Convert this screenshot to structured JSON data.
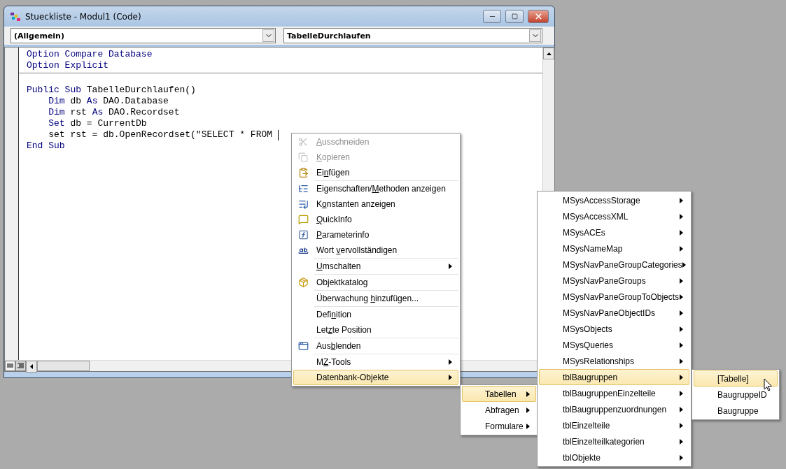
{
  "window": {
    "title": "Stueckliste - Modul1 (Code)"
  },
  "object_combo": {
    "value": "(Allgemein)"
  },
  "procedure_combo": {
    "value": "TabelleDurchlaufen"
  },
  "code": {
    "sections": [
      {
        "lines": [
          {
            "tokens": [
              {
                "kind": "keyword",
                "text": "Option Compare Database"
              }
            ]
          },
          {
            "tokens": [
              {
                "kind": "keyword",
                "text": "Option Explicit"
              }
            ]
          }
        ]
      },
      {
        "lines": [
          {
            "tokens": [
              {
                "kind": "keyword",
                "text": "Public Sub"
              },
              {
                "kind": "plain",
                "text": " TabelleDurchlaufen()"
              }
            ]
          },
          {
            "tokens": [
              {
                "kind": "keyword",
                "text": "    Dim"
              },
              {
                "kind": "plain",
                "text": " db "
              },
              {
                "kind": "keyword",
                "text": "As"
              },
              {
                "kind": "plain",
                "text": " DAO.Database"
              }
            ]
          },
          {
            "tokens": [
              {
                "kind": "keyword",
                "text": "    Dim"
              },
              {
                "kind": "plain",
                "text": " rst "
              },
              {
                "kind": "keyword",
                "text": "As"
              },
              {
                "kind": "plain",
                "text": " DAO.Recordset"
              }
            ]
          },
          {
            "tokens": [
              {
                "kind": "keyword",
                "text": "    Set"
              },
              {
                "kind": "plain",
                "text": " db = CurrentDb"
              }
            ]
          },
          {
            "tokens": [
              {
                "kind": "plain",
                "text": "    set rst = db.OpenRecordset(\"SELECT * FROM "
              }
            ],
            "cursor": true
          },
          {
            "tokens": [
              {
                "kind": "keyword",
                "text": "End Sub"
              }
            ]
          }
        ]
      }
    ]
  },
  "context_menu": {
    "groups": [
      {
        "items": [
          {
            "label": {
              "key": "A",
              "post": "usschneiden"
            },
            "disabled": true,
            "submenu": false,
            "selected": false
          },
          {
            "label": {
              "key": "K",
              "post": "opieren"
            },
            "disabled": true,
            "submenu": false,
            "selected": false
          },
          {
            "label": {
              "pre": "Ei",
              "key": "n",
              "post": "fügen"
            },
            "disabled": false,
            "submenu": false,
            "selected": false
          }
        ]
      },
      {
        "items": [
          {
            "label": {
              "pre": "Eigenschaften/",
              "key": "M",
              "post": "ethoden anzeigen"
            },
            "disabled": false,
            "submenu": false,
            "selected": false
          },
          {
            "label": {
              "pre": "K",
              "key": "o",
              "post": "nstanten anzeigen"
            },
            "disabled": false,
            "submenu": false,
            "selected": false
          },
          {
            "label": {
              "key": "Q",
              "post": "uickInfo"
            },
            "disabled": false,
            "submenu": false,
            "selected": false
          },
          {
            "label": {
              "key": "P",
              "post": "arameterinfo"
            },
            "disabled": false,
            "submenu": false,
            "selected": false
          },
          {
            "label": {
              "pre": "Wort ",
              "key": "v",
              "post": "ervollständigen"
            },
            "disabled": false,
            "submenu": false,
            "selected": false
          }
        ]
      },
      {
        "items": [
          {
            "label": {
              "key": "U",
              "post": "mschalten"
            },
            "disabled": false,
            "submenu": true,
            "selected": false
          }
        ]
      },
      {
        "items": [
          {
            "label": {
              "pre": "Ob",
              "key": "j",
              "post": "ektkatalog"
            },
            "disabled": false,
            "submenu": false,
            "selected": false
          }
        ]
      },
      {
        "items": [
          {
            "label": {
              "pre": "Überwachung ",
              "key": "h",
              "post": "inzufügen..."
            },
            "disabled": false,
            "submenu": false,
            "selected": false
          }
        ]
      },
      {
        "items": [
          {
            "label": {
              "pre": "Defi",
              "key": "n",
              "post": "ition"
            },
            "disabled": false,
            "submenu": false,
            "selected": false
          },
          {
            "label": {
              "pre": "Let",
              "key": "z",
              "post": "te Position"
            },
            "disabled": false,
            "submenu": false,
            "selected": false
          }
        ]
      },
      {
        "items": [
          {
            "label": {
              "pre": "Aus",
              "key": "b",
              "post": "lenden"
            },
            "disabled": false,
            "submenu": false,
            "selected": false
          }
        ]
      },
      {
        "items": [
          {
            "label": {
              "pre": "M",
              "key": "Z",
              "post": "-Tools"
            },
            "disabled": false,
            "submenu": true,
            "selected": false
          },
          {
            "label": {
              "pre": "Datenbank-Objekte"
            },
            "disabled": false,
            "submenu": true,
            "selected": true
          }
        ]
      }
    ]
  },
  "submenus": [
    {
      "items": [
        {
          "label": "Tabellen",
          "submenu": true,
          "selected": true
        },
        {
          "label": "Abfragen",
          "submenu": true,
          "selected": false
        },
        {
          "label": "Formulare",
          "submenu": true,
          "selected": false
        }
      ]
    },
    {
      "items": [
        {
          "label": "MSysAccessStorage",
          "submenu": true,
          "selected": false
        },
        {
          "label": "MSysAccessXML",
          "submenu": true,
          "selected": false
        },
        {
          "label": "MSysACEs",
          "submenu": true,
          "selected": false
        },
        {
          "label": "MSysNameMap",
          "submenu": true,
          "selected": false
        },
        {
          "label": "MSysNavPaneGroupCategories",
          "submenu": true,
          "selected": false
        },
        {
          "label": "MSysNavPaneGroups",
          "submenu": true,
          "selected": false
        },
        {
          "label": "MSysNavPaneGroupToObjects",
          "submenu": true,
          "selected": false
        },
        {
          "label": "MSysNavPaneObjectIDs",
          "submenu": true,
          "selected": false
        },
        {
          "label": "MSysObjects",
          "submenu": true,
          "selected": false
        },
        {
          "label": "MSysQueries",
          "submenu": true,
          "selected": false
        },
        {
          "label": "MSysRelationships",
          "submenu": true,
          "selected": false
        },
        {
          "label": "tblBaugruppen",
          "submenu": true,
          "selected": true
        },
        {
          "label": "tblBaugruppenEinzelteile",
          "submenu": true,
          "selected": false
        },
        {
          "label": "tblBaugruppenzuordnungen",
          "submenu": true,
          "selected": false
        },
        {
          "label": "tblEinzelteile",
          "submenu": true,
          "selected": false
        },
        {
          "label": "tblEinzelteilkategorien",
          "submenu": true,
          "selected": false
        },
        {
          "label": "tblObjekte",
          "submenu": true,
          "selected": false
        }
      ]
    },
    {
      "items": [
        {
          "label": "[Tabelle]",
          "submenu": false,
          "selected": true
        },
        {
          "label": "BaugruppeID",
          "submenu": false,
          "selected": false
        },
        {
          "label": "Baugruppe",
          "submenu": false,
          "selected": false
        }
      ]
    }
  ]
}
